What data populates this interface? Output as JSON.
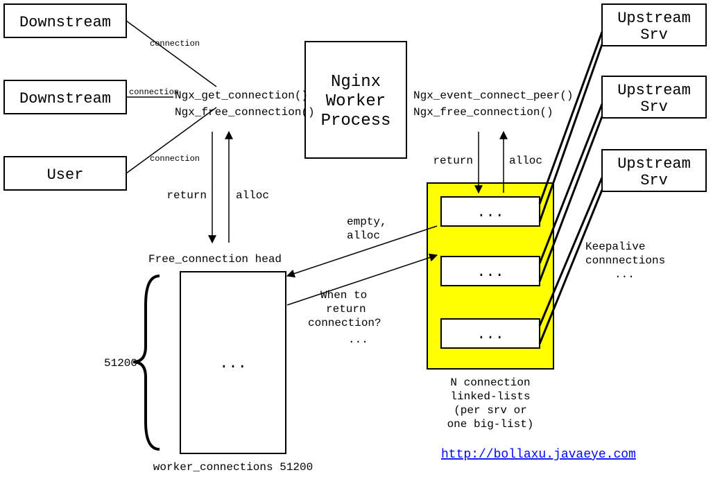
{
  "boxes": {
    "downstream1": "Downstream",
    "downstream2": "Downstream",
    "user": "User",
    "nginx_l1": "Nginx",
    "nginx_l2": "Worker",
    "nginx_l3": "Process",
    "upstream1_l1": "Upstream",
    "upstream1_l2": "Srv",
    "upstream2_l1": "Upstream",
    "upstream2_l2": "Srv",
    "upstream3_l1": "Upstream",
    "upstream3_l2": "Srv"
  },
  "labels": {
    "conn1": "connection",
    "conn2": "connection",
    "conn3": "connection",
    "get_conn": "Ngx_get_connection()",
    "free_conn": "Ngx_free_connection()",
    "event_peer": "Ngx_event_connect_peer()",
    "free_conn2": "Ngx_free_connection()",
    "return1": "return",
    "alloc1": "alloc",
    "return2": "return",
    "alloc2": "alloc",
    "empty_alloc_l1": "empty,",
    "empty_alloc_l2": "alloc",
    "when_l1": "When to",
    "when_l2": "return",
    "when_l3": "connection?",
    "when_l4": "...",
    "free_head": "Free_connection head",
    "dots1": "...",
    "dots2": "...",
    "dots3": "...",
    "dots4": "...",
    "size": "51200",
    "worker_conns": "worker_connections 51200",
    "nconn_l1": "N connection",
    "nconn_l2": "linked-lists",
    "nconn_l3": "(per srv or",
    "nconn_l4": "one big-list)",
    "keepalive_l1": "Keepalive",
    "keepalive_l2": "connnections",
    "keepalive_l3": "...",
    "url": "http://bollaxu.javaeye.com"
  }
}
